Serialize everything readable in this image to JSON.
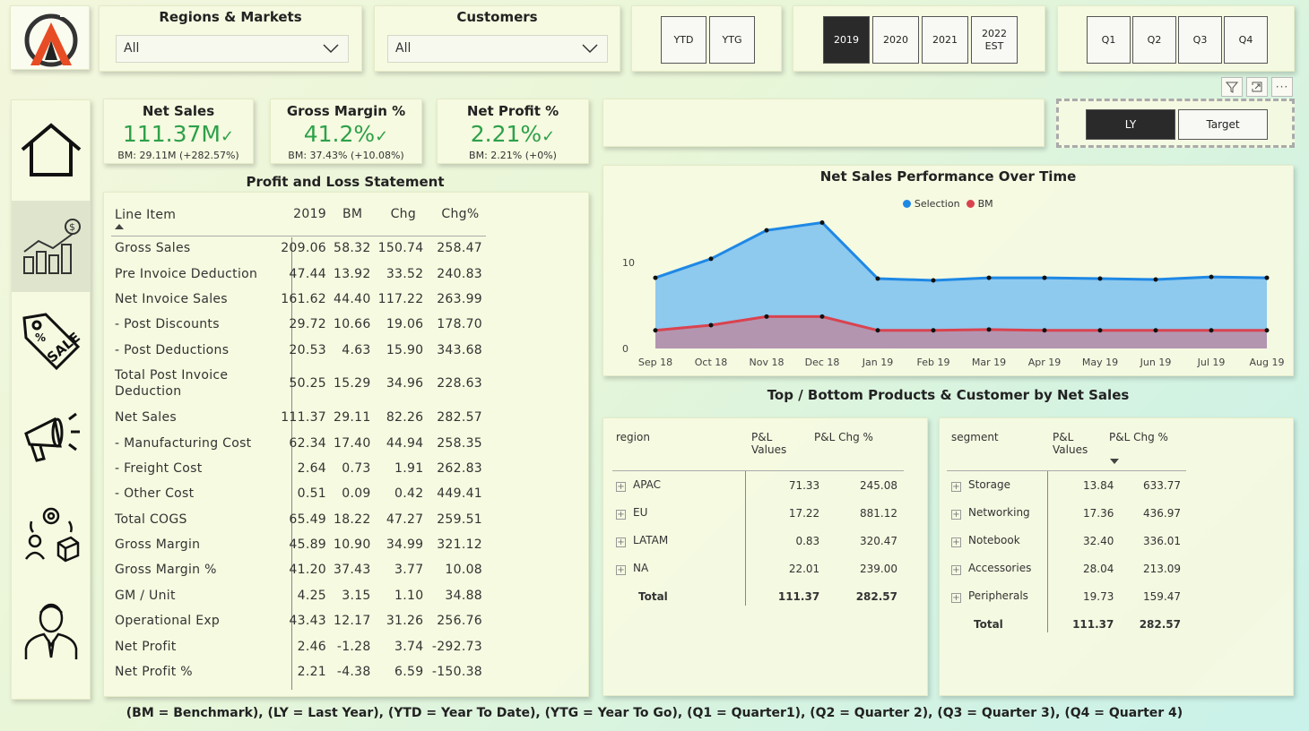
{
  "slicers": {
    "regions": {
      "title": "Regions & Markets",
      "value": "All"
    },
    "customers": {
      "title": "Customers",
      "value": "All"
    }
  },
  "period_buttons": [
    "YTD",
    "YTG"
  ],
  "years": [
    {
      "label": "2019",
      "active": true
    },
    {
      "label": "2020",
      "active": false
    },
    {
      "label": "2021",
      "active": false
    },
    {
      "label": "2022\nEST",
      "active": false
    }
  ],
  "quarters": [
    "Q1",
    "Q2",
    "Q3",
    "Q4"
  ],
  "compare_toggle": [
    {
      "label": "LY",
      "active": true
    },
    {
      "label": "Target",
      "active": false
    }
  ],
  "header_icons": [
    "filter-icon",
    "focus-mode-icon",
    "more-options-icon"
  ],
  "nav": [
    {
      "name": "home-icon"
    },
    {
      "name": "finance-chart-icon",
      "active": true
    },
    {
      "name": "sale-tag-icon"
    },
    {
      "name": "marketing-megaphone-icon"
    },
    {
      "name": "supply-chain-icon"
    },
    {
      "name": "executive-icon"
    }
  ],
  "kpis": [
    {
      "title": "Net Sales",
      "value": "111.37M",
      "sub": "BM: 29.11M (+282.57%)"
    },
    {
      "title": "Gross Margin %",
      "value": "41.2%",
      "sub": "BM: 37.43% (+10.08%)"
    },
    {
      "title": "Net Profit %",
      "value": "2.21%",
      "sub": "BM: 2.21% (+0%)"
    }
  ],
  "pl": {
    "title": "Profit and Loss Statement",
    "headers": [
      "Line Item",
      "2019",
      "BM",
      "Chg",
      "Chg%"
    ],
    "rows": [
      [
        "Gross Sales",
        "209.06",
        "58.32",
        "150.74",
        "258.47"
      ],
      [
        "Pre Invoice Deduction",
        "47.44",
        "13.92",
        "33.52",
        "240.83"
      ],
      [
        "Net Invoice Sales",
        "161.62",
        "44.40",
        "117.22",
        "263.99"
      ],
      [
        "- Post Discounts",
        "29.72",
        "10.66",
        "19.06",
        "178.70"
      ],
      [
        "- Post Deductions",
        "20.53",
        "4.63",
        "15.90",
        "343.68"
      ],
      [
        "Total Post Invoice Deduction",
        "50.25",
        "15.29",
        "34.96",
        "228.63"
      ],
      [
        "Net Sales",
        "111.37",
        "29.11",
        "82.26",
        "282.57"
      ],
      [
        "- Manufacturing Cost",
        "62.34",
        "17.40",
        "44.94",
        "258.35"
      ],
      [
        "- Freight Cost",
        "2.64",
        "0.73",
        "1.91",
        "262.83"
      ],
      [
        "- Other Cost",
        "0.51",
        "0.09",
        "0.42",
        "449.41"
      ],
      [
        "Total COGS",
        "65.49",
        "18.22",
        "47.27",
        "259.51"
      ],
      [
        "Gross Margin",
        "45.89",
        "10.90",
        "34.99",
        "321.12"
      ],
      [
        "Gross Margin %",
        "41.20",
        "37.43",
        "3.77",
        "10.08"
      ],
      [
        "GM / Unit",
        "4.25",
        "3.15",
        "1.10",
        "34.88"
      ],
      [
        "Operational Exp",
        "43.43",
        "12.17",
        "31.26",
        "256.76"
      ],
      [
        "Net Profit",
        "2.46",
        "-1.28",
        "3.74",
        "-292.73"
      ],
      [
        "Net Profit %",
        "2.21",
        "-4.38",
        "6.59",
        "-150.38"
      ]
    ]
  },
  "chart_data": {
    "type": "area",
    "title": "Net Sales Performance Over Time",
    "categories": [
      "Sep 18",
      "Oct 18",
      "Nov 18",
      "Dec 18",
      "Jan 19",
      "Feb 19",
      "Mar 19",
      "Apr 19",
      "May 19",
      "Jun 19",
      "Jul 19",
      "Aug 19"
    ],
    "series": [
      {
        "name": "Selection",
        "color": "#1e88e5",
        "values": [
          8.2,
          10.4,
          13.7,
          14.6,
          8.1,
          7.9,
          8.2,
          8.2,
          8.1,
          8.0,
          8.3,
          8.2
        ]
      },
      {
        "name": "BM",
        "color": "#d9434f",
        "values": [
          2.1,
          2.7,
          3.7,
          3.7,
          2.1,
          2.1,
          2.2,
          2.1,
          2.1,
          2.1,
          2.1,
          2.1
        ]
      }
    ],
    "yticks": [
      "0",
      "10"
    ],
    "ylim": [
      0,
      16
    ],
    "legend": "top"
  },
  "bottom_title": "Top / Bottom Products & Customer by Net Sales",
  "region_table": {
    "headers": [
      "region",
      "P&L\nValues",
      "P&L Chg %"
    ],
    "rows": [
      [
        "APAC",
        "71.33",
        "245.08"
      ],
      [
        "EU",
        "17.22",
        "881.12"
      ],
      [
        "LATAM",
        "0.83",
        "320.47"
      ],
      [
        "NA",
        "22.01",
        "239.00"
      ]
    ],
    "total": [
      "Total",
      "111.37",
      "282.57"
    ]
  },
  "segment_table": {
    "headers": [
      "segment",
      "P&L\nValues",
      "P&L Chg %"
    ],
    "rows": [
      [
        "Storage",
        "13.84",
        "633.77"
      ],
      [
        "Networking",
        "17.36",
        "436.97"
      ],
      [
        "Notebook",
        "32.40",
        "336.01"
      ],
      [
        "Accessories",
        "28.04",
        "213.09"
      ],
      [
        "Peripherals",
        "19.73",
        "159.47"
      ]
    ],
    "total": [
      "Total",
      "111.37",
      "282.57"
    ]
  },
  "footer": "(BM = Benchmark), (LY = Last Year), (YTD = Year To Date), (YTG = Year To Go), (Q1 = Quarter1), (Q2 = Quarter 2), (Q3 = Quarter 3), (Q4 = Quarter 4)"
}
